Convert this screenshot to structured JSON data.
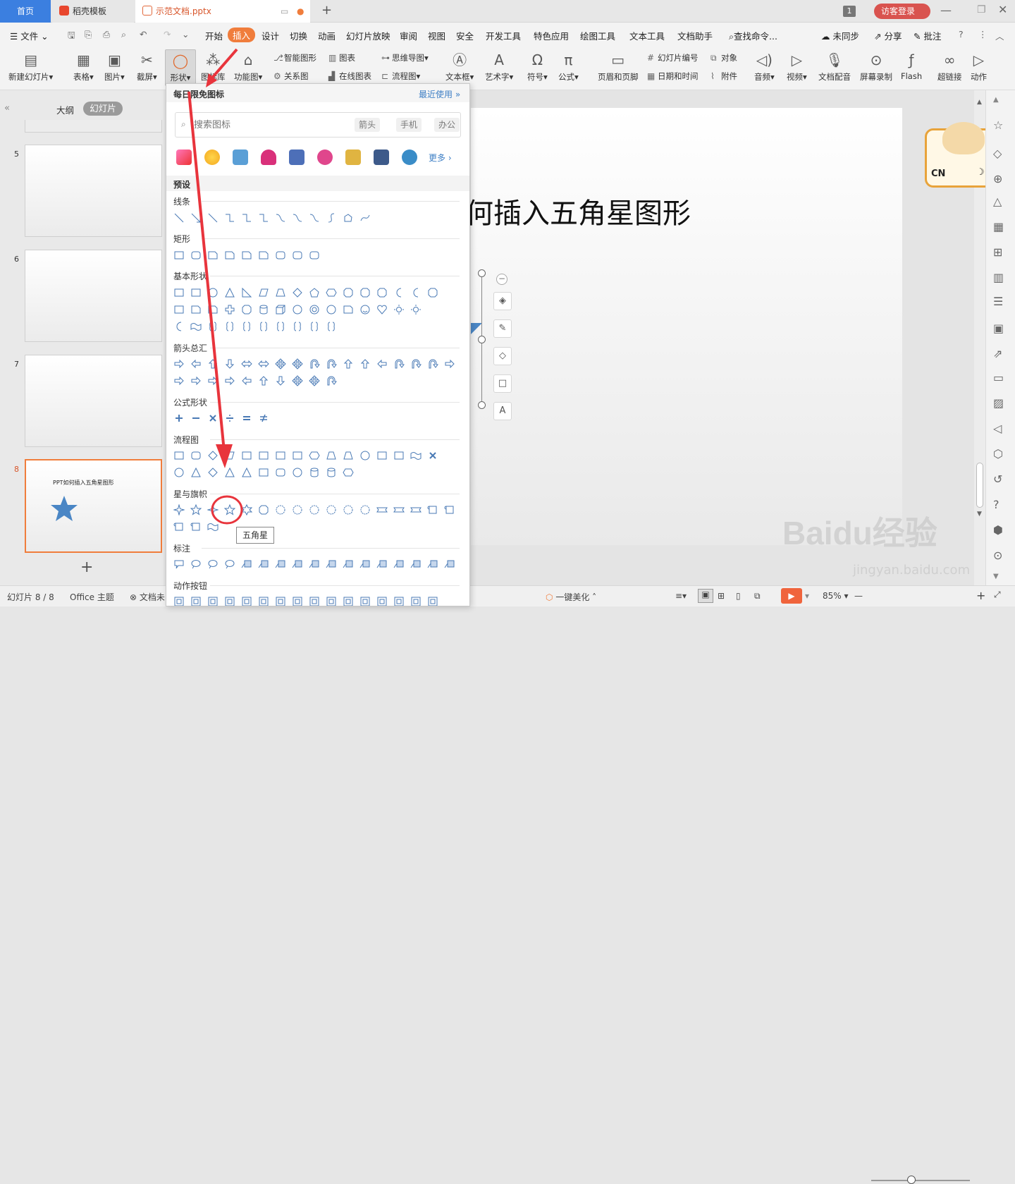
{
  "tabs": [
    {
      "label": "首页"
    },
    {
      "label": "稻壳模板"
    },
    {
      "label": "示范文档.pptx"
    }
  ],
  "window": {
    "badge": "1",
    "login": "访客登录"
  },
  "menu": {
    "file": "文件",
    "items": [
      "开始",
      "插入",
      "设计",
      "切换",
      "动画",
      "幻灯片放映",
      "审阅",
      "视图",
      "安全",
      "开发工具",
      "特色应用",
      "绘图工具",
      "文本工具",
      "文档助手"
    ],
    "search": "查找命令...",
    "sync": "未同步",
    "share": "分享",
    "comment": "批注"
  },
  "ribbon": {
    "new_slide": "新建幻灯片",
    "table": "表格",
    "picture": "图片",
    "screenshot": "截屏",
    "shape": "形状",
    "icon_lib": "图标库",
    "func_chart": "功能图",
    "smart": "智能图形",
    "chart": "图表",
    "mind": "思维导图",
    "relation": "关系图",
    "online_chart": "在线图表",
    "flow": "流程图",
    "textbox": "文本框",
    "wordart": "艺术字",
    "symbol": "符号",
    "formula": "公式",
    "header_footer": "页眉和页脚",
    "slide_num": "幻灯片编号",
    "object": "对象",
    "datetime": "日期和时间",
    "attach": "附件",
    "audio": "音频",
    "video": "视频",
    "doc_voice": "文档配音",
    "screen_rec": "屏幕录制",
    "flash": "Flash",
    "hyperlink": "超链接",
    "action": "动作"
  },
  "left": {
    "outline": "大纲",
    "slides": "幻灯片",
    "numbers": [
      "5",
      "6",
      "7",
      "8"
    ],
    "thumb8_title": "PPT如何插入五角星图形"
  },
  "slide": {
    "title": "何插入五角星图形"
  },
  "ime": {
    "text": "CN"
  },
  "dropdown": {
    "header": "每日限免图标",
    "recent": "最近使用",
    "search_placeholder": "搜索图标",
    "tags": [
      "箭头",
      "手机",
      "办公"
    ],
    "more": "更多",
    "preset": "预设",
    "sections": {
      "lines": "线条",
      "rect": "矩形",
      "basic": "基本形状",
      "arrows": "箭头总汇",
      "formula": "公式形状",
      "flow": "流程图",
      "stars": "星与旗帜",
      "callout": "标注",
      "action": "动作按钮"
    },
    "tooltip": "五角星"
  },
  "status": {
    "slide_info": "幻灯片 8 / 8",
    "theme": "Office 主题",
    "doc": "文档未",
    "beautify": "一键美化",
    "zoom": "85%"
  },
  "watermark": {
    "brand": "Baidu经验",
    "url": "jingyan.baidu.com"
  },
  "colors": {
    "accent": "#f07d3c",
    "shape": "#4a86c5",
    "red": "#e8343c",
    "star": "#3e7fc5"
  }
}
